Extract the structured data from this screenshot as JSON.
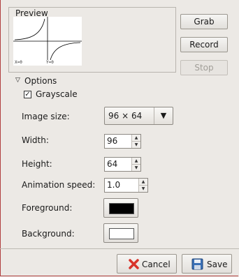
{
  "preview": {
    "label": "Preview",
    "graph_label_x": "X=0",
    "graph_label_y": "Y=0"
  },
  "buttons": {
    "grab": "Grab",
    "record": "Record",
    "stop": "Stop"
  },
  "options": {
    "expander_label": "Options",
    "grayscale_label": "Grayscale",
    "grayscale_checked": true,
    "image_size_label": "Image size:",
    "image_size_value": "96 × 64",
    "width_label": "Width:",
    "width_value": "96",
    "height_label": "Height:",
    "height_value": "64",
    "anim_speed_label": "Animation speed:",
    "anim_speed_value": "1.0",
    "foreground_label": "Foreground:",
    "foreground_color": "#000000",
    "background_label": "Background:",
    "background_color": "#ffffff"
  },
  "actions": {
    "cancel": "Cancel",
    "save": "Save"
  }
}
